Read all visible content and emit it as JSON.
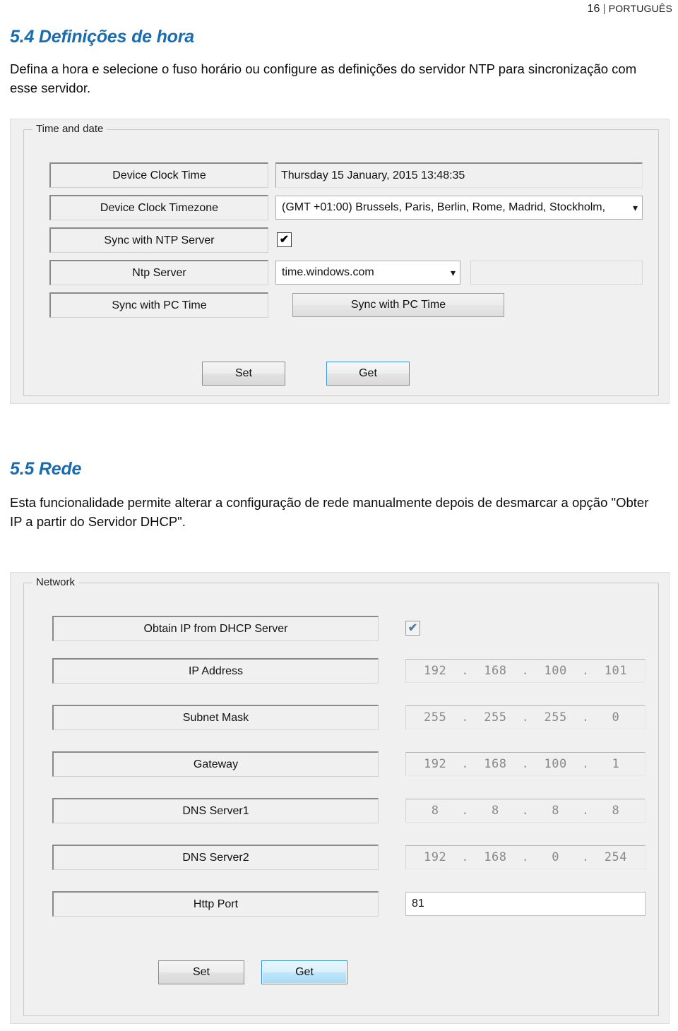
{
  "page_header": {
    "number": "16",
    "separator": "|",
    "language": "PORTUGUÊS"
  },
  "sections": {
    "time": {
      "heading": "5.4 Definições de hora",
      "paragraph": "Defina a hora e selecione o fuso horário ou configure as definições do servidor NTP para sincronização com esse servidor."
    },
    "network": {
      "heading": "5.5 Rede",
      "paragraph": "Esta funcionalidade permite alterar a configuração de rede manualmente depois de desmarcar a opção \"Obter IP a partir do Servidor DHCP\"."
    }
  },
  "time_panel": {
    "group_title": "Time and date",
    "rows": {
      "device_clock_time": {
        "label": "Device Clock Time",
        "value": "Thursday 15 January, 2015 13:48:35"
      },
      "device_clock_timezone": {
        "label": "Device Clock Timezone",
        "value": "(GMT +01:00) Brussels, Paris, Berlin, Rome, Madrid, Stockholm,",
        "chevron": "chevron-down-icon"
      },
      "sync_with_ntp_server": {
        "label": "Sync with NTP Server",
        "checked": true,
        "check_glyph": "✔"
      },
      "ntp_server": {
        "label": "Ntp Server",
        "value": "time.windows.com",
        "chevron": "chevron-down-icon",
        "extra_field_value": ""
      },
      "sync_with_pc_time": {
        "label": "Sync with PC Time",
        "button_label": "Sync with PC Time"
      }
    },
    "buttons": {
      "set": "Set",
      "get": "Get"
    }
  },
  "network_panel": {
    "group_title": "Network",
    "rows": {
      "obtain_ip_dhcp": {
        "label": "Obtain IP from DHCP Server",
        "checked": true,
        "check_glyph": "✔"
      },
      "ip_address": {
        "label": "IP Address",
        "octets": [
          "192",
          "168",
          "100",
          "101"
        ]
      },
      "subnet_mask": {
        "label": "Subnet Mask",
        "octets": [
          "255",
          "255",
          "255",
          "0"
        ]
      },
      "gateway": {
        "label": "Gateway",
        "octets": [
          "192",
          "168",
          "100",
          "1"
        ]
      },
      "dns_server1": {
        "label": "DNS Server1",
        "octets": [
          "8",
          "8",
          "8",
          "8"
        ]
      },
      "dns_server2": {
        "label": "DNS Server2",
        "octets": [
          "192",
          "168",
          "0",
          "254"
        ]
      },
      "http_port": {
        "label": "Http Port",
        "value": "81"
      }
    },
    "buttons": {
      "set": "Set",
      "get": "Get"
    }
  },
  "colors": {
    "heading_blue": "#1a6cb0",
    "panel_background": "#f0f0f0",
    "focus_blue": "#3d9be0",
    "hot_blue": "#2c94d4",
    "disabled_text": "#8a8a8a"
  }
}
